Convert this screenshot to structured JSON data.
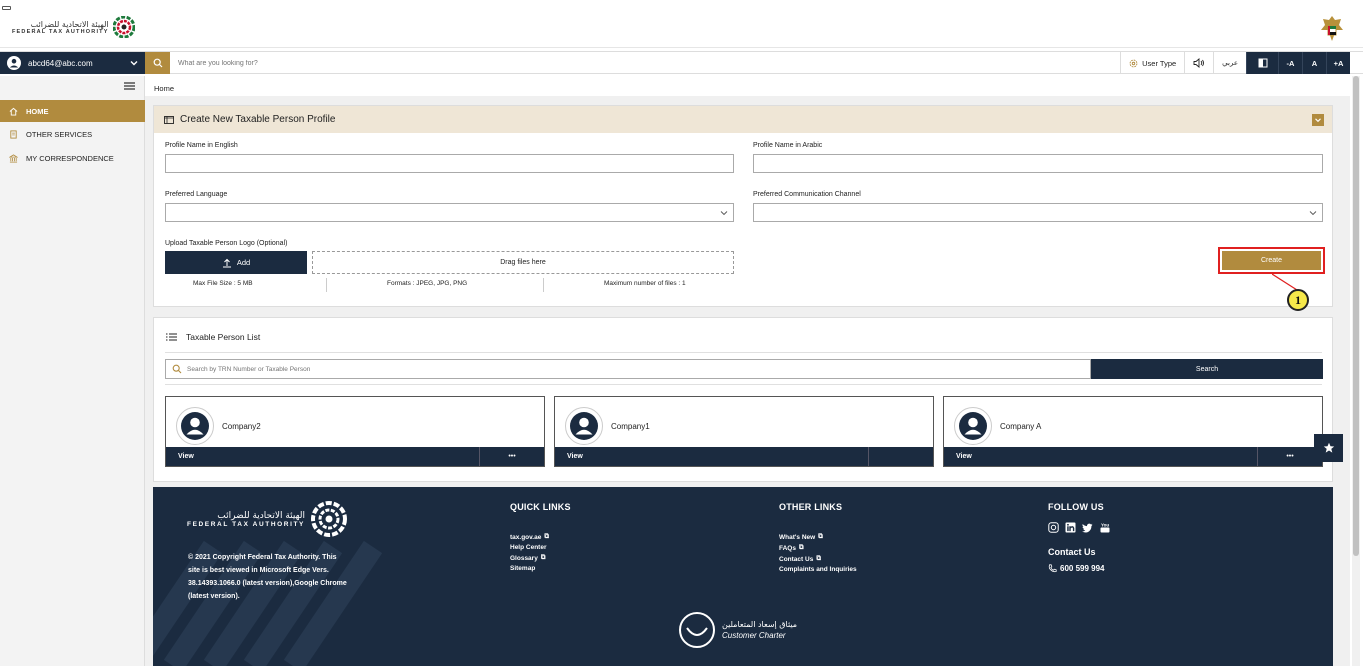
{
  "header": {
    "logo_ar": "الهيئة الاتحادية للضرائب",
    "logo_en": "FEDERAL TAX AUTHORITY"
  },
  "navbar": {
    "user_email": "abcd64@abc.com",
    "search_placeholder": "What are you looking for?",
    "user_type_label": "User Type",
    "arabic_label": "عربي",
    "font_decrease": "-A",
    "font_default": "A",
    "font_increase": "+A"
  },
  "sidebar": {
    "items": [
      {
        "label": "HOME",
        "icon": "home-icon"
      },
      {
        "label": "OTHER SERVICES",
        "icon": "document-icon"
      },
      {
        "label": "MY CORRESPONDENCE",
        "icon": "building-icon"
      }
    ]
  },
  "breadcrumb": "Home",
  "create_profile": {
    "title": "Create New Taxable Person Profile",
    "profile_name_en_label": "Profile Name in English",
    "profile_name_en_value": "",
    "profile_name_ar_label": "Profile Name in Arabic",
    "profile_name_ar_value": "",
    "preferred_language_label": "Preferred Language",
    "preferred_language_value": "",
    "preferred_channel_label": "Preferred Communication Channel",
    "preferred_channel_value": "",
    "upload_label": "Upload Taxable Person Logo (Optional)",
    "add_label": "Add",
    "drop_label": "Drag files here",
    "max_size": "Max File Size : 5 MB",
    "formats": "Formats : JPEG, JPG, PNG",
    "max_files": "Maximum number of files : 1",
    "create_label": "Create",
    "callout_number": "1"
  },
  "taxable_list": {
    "title": "Taxable Person List",
    "search_placeholder": "Search by TRN Number or Taxable Person",
    "search_label": "Search",
    "cards": [
      {
        "name": "Company2",
        "view": "View",
        "more": "•••"
      },
      {
        "name": "Company1",
        "view": "View",
        "more": ""
      },
      {
        "name": "Company A",
        "view": "View",
        "more": "•••"
      }
    ]
  },
  "footer": {
    "logo_ar": "الهيئة الاتحادية للضرائب",
    "logo_en": "FEDERAL TAX AUTHORITY",
    "copyright": "© 2021 Copyright Federal Tax Authority. This site is best viewed in Microsoft Edge Vers. 38.14393.1066.0 (latest version),Google Chrome (latest version).",
    "quick_links_title": "QUICK LINKS",
    "quick_links": [
      "tax.gov.ae",
      "Help Center",
      "Glossary",
      "Sitemap"
    ],
    "other_links_title": "OTHER LINKS",
    "other_links": [
      "What's New",
      "FAQs",
      "Contact Us",
      "Complaints and Inquiries"
    ],
    "follow_title": "FOLLOW US",
    "contact_title": "Contact Us",
    "phone": "600 599 994",
    "charter_ar": "ميثاق إسعاد المتعاملين",
    "charter_en": "Customer Charter"
  },
  "colors": {
    "navy": "#1b2b40",
    "gold": "#b18b3e",
    "panel_head": "#efe6d6",
    "highlight_red": "#e02020"
  }
}
